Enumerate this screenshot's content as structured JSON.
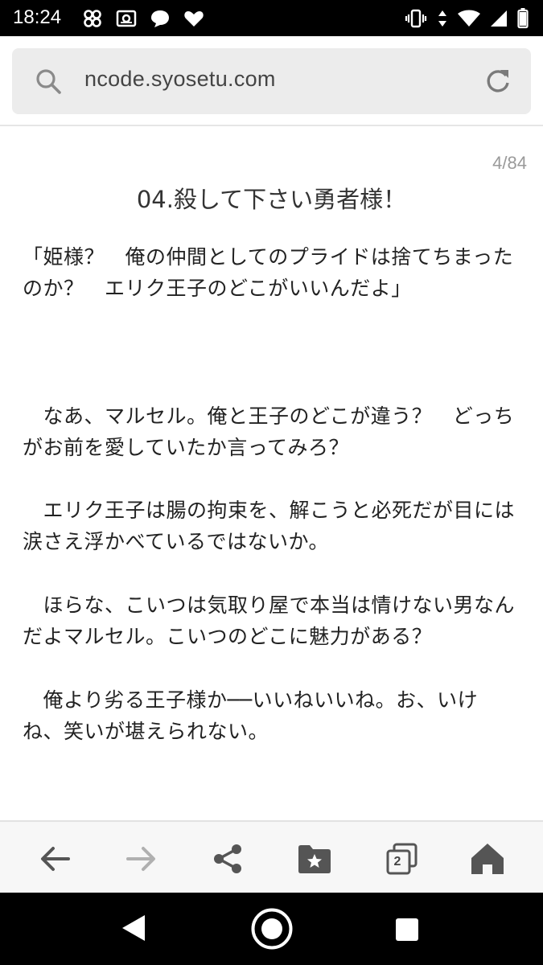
{
  "status_bar": {
    "time": "18:24",
    "left_icons": [
      "pinwheel-icon",
      "radio-icon",
      "chat-bubble-icon",
      "heart-icon"
    ],
    "right_icons": [
      "vibrate-icon",
      "data-arrows-icon",
      "wifi-icon",
      "signal-icon",
      "battery-icon"
    ]
  },
  "url_bar": {
    "url": "ncode.syosetu.com"
  },
  "page_counter": "4/84",
  "chapter_title": "04.殺して下さい勇者様！",
  "paragraphs": [
    "「姫様？　俺の仲間としてのプライドは捨てちまったのか？　エリク王子のどこがいいんだよ」",
    "　なあ、マルセル。俺と王子のどこが違う？　どっちがお前を愛していたか言ってみろ？",
    "　エリク王子は腸の拘束を、解こうと必死だが目には涙さえ浮かべているではないか。",
    "　ほらな、こいつは気取り屋で本当は情けない男なんだよマルセル。こいつのどこに魅力がある？",
    "　俺より劣る王子様か──いいねいいね。お、いけね、笑いが堪えられない。"
  ],
  "toolbar": {
    "tab_count": "2",
    "buttons": [
      "back",
      "forward",
      "share",
      "bookmarks",
      "tabs",
      "home"
    ]
  },
  "colors": {
    "status_bar_bg": "#000000",
    "url_bar_bg": "#ececec",
    "text": "#222222",
    "muted": "#9a9a9a",
    "icon": "#555555",
    "icon_disabled": "#b0b0b0"
  }
}
